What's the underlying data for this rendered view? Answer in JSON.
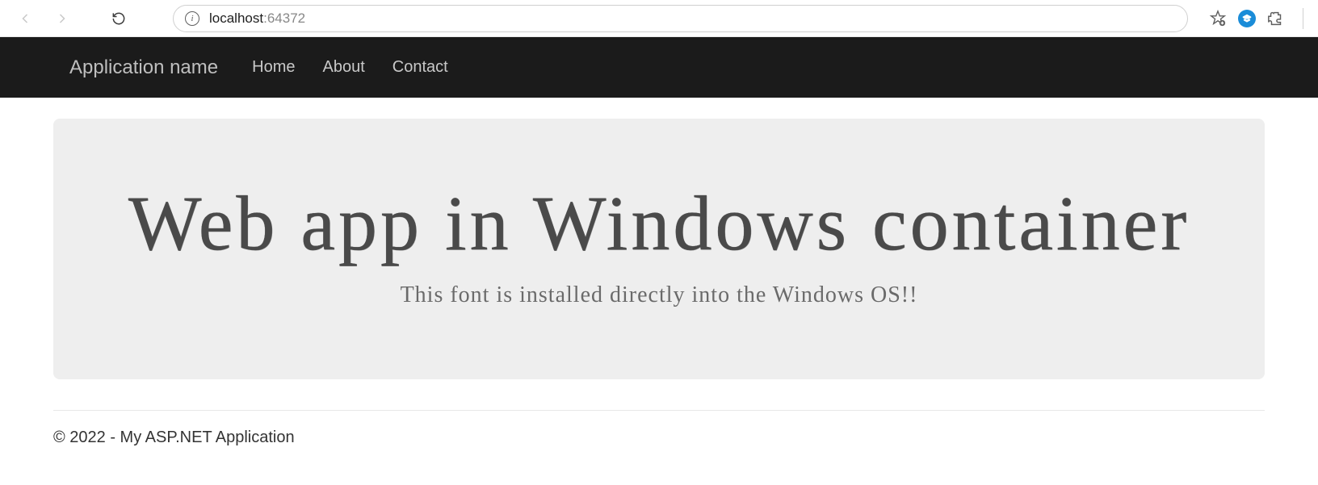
{
  "browser": {
    "url_host": "localhost",
    "url_port": ":64372"
  },
  "navbar": {
    "brand": "Application name",
    "links": [
      "Home",
      "About",
      "Contact"
    ]
  },
  "jumbotron": {
    "heading": "Web app in Windows container",
    "subtext": "This font is installed directly into the Windows OS!!"
  },
  "footer": {
    "text": "© 2022 - My ASP.NET Application"
  }
}
